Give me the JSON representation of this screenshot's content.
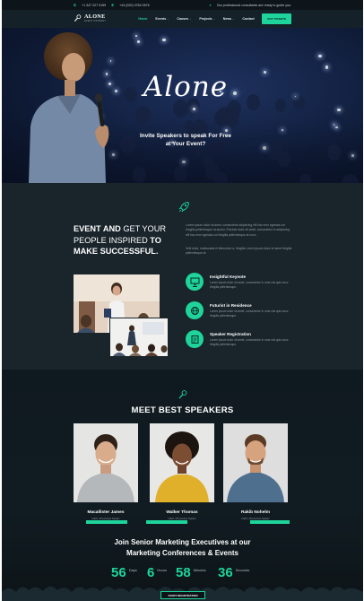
{
  "topbar": {
    "phone": "+1 347 227 0159",
    "phone2": "+44 (020) 0764 0676",
    "notice": "Our professional consultants are ready to guide you."
  },
  "navbar": {
    "logo_name": "ALONE",
    "logo_tag": "EVENT COMPANY",
    "items": [
      {
        "label": "Home",
        "active": true,
        "caret": false
      },
      {
        "label": "Events",
        "active": false,
        "caret": true
      },
      {
        "label": "Causes",
        "active": false,
        "caret": true
      },
      {
        "label": "Projects",
        "active": false,
        "caret": true
      },
      {
        "label": "News",
        "active": false,
        "caret": true
      },
      {
        "label": "Contact",
        "active": false,
        "caret": false
      }
    ],
    "cta": "BUY TICKETS",
    "caret_glyph": "⌄"
  },
  "hero": {
    "script_title": "Alone",
    "subtitle_line1": "Invite Speakers to speak For Free",
    "subtitle_line2": "at Your Event?"
  },
  "about": {
    "title_bold1": "EVENT AND",
    "title_thin1": "GET YOUR",
    "title_thin2": "PEOPLE INSPIRED",
    "title_bold2": "TO",
    "title_bold3": "MAKE SUCCESSFUL.",
    "para1": "Lorem ipsum dolor sit amet, consectetur adipiscing elit hac eros egestas out fringilla pellentesque at auctor. Pulvinar dolor sit amet, consectetur in adipiscing elit hac eros egestas out fringilla pellentesque at nunc.",
    "para2": "Velit dolor, malesuada et bibendum a, fringilla Lorem ipsum dolor sit amet fringilla pellentesque at.",
    "features": [
      {
        "title": "Insightful Keynote",
        "desc": "Lorem ipsum dolor sit amet, consectetur in urna nisl quis nunc fringilla pellentesque.",
        "icon": "presenter-icon"
      },
      {
        "title": "Futurist in Residence",
        "desc": "Lorem ipsum dolor sit amet, consectetur in urna nisl quis nunc fringilla pellentesque.",
        "icon": "globe-icon"
      },
      {
        "title": "Speaker Registration",
        "desc": "Lorem ipsum dolor sit amet, consectetur in urna nisl quis nunc fringilla pellentesque.",
        "icon": "registration-icon"
      }
    ]
  },
  "speakers": {
    "title": "MEET BEST SPEAKERS",
    "list": [
      {
        "name": "Macallister James",
        "role": "CEO, Photoshot Spider"
      },
      {
        "name": "Walker Thomas",
        "role": "CEO, Photoshot Spider"
      },
      {
        "name": "Rakib Nohelm",
        "role": "CEO, Photoshot Spider"
      }
    ],
    "join_line1": "Join Senior Marketing Executives at our",
    "join_line2": "Marketing Conferences & Events",
    "countdown": [
      {
        "value": "56",
        "label": "Days"
      },
      {
        "value": "6",
        "label": "Hours"
      },
      {
        "value": "58",
        "label": "Minutes"
      },
      {
        "value": "36",
        "label": "Seconds"
      }
    ],
    "button": "START REGISTRATION"
  },
  "colors": {
    "accent": "#1ed49a",
    "dark_bg": "#121d24",
    "section_bg": "#19242b"
  }
}
